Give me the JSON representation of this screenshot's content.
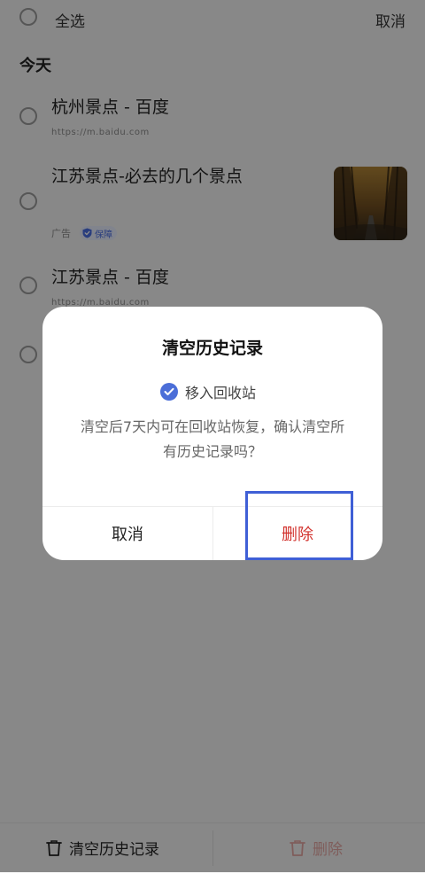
{
  "topbar": {
    "select_all": "全选",
    "cancel": "取消"
  },
  "section": {
    "today": "今天"
  },
  "items": [
    {
      "title": "杭州景点 - 百度",
      "url": "https://m.baidu.com"
    },
    {
      "title": "江苏景点-必去的几个景点",
      "ad_label": "广告",
      "badge": "保障"
    },
    {
      "title": "江苏景点 - 百度",
      "url": "https://m.baidu.com"
    }
  ],
  "dialog": {
    "title": "清空历史记录",
    "checkbox_label": "移入回收站",
    "message": "清空后7天内可在回收站恢复，确认清空所有历史记录吗？",
    "cancel": "取消",
    "delete": "删除"
  },
  "bottom": {
    "clear_all": "清空历史记录",
    "delete": "删除"
  },
  "colors": {
    "accent": "#4b6ed8",
    "danger": "#d2322d",
    "highlight": "#3f5fd6"
  },
  "icons": {
    "checkbox": "check-circle-icon",
    "trash": "trash-icon",
    "shield": "shield-icon"
  }
}
